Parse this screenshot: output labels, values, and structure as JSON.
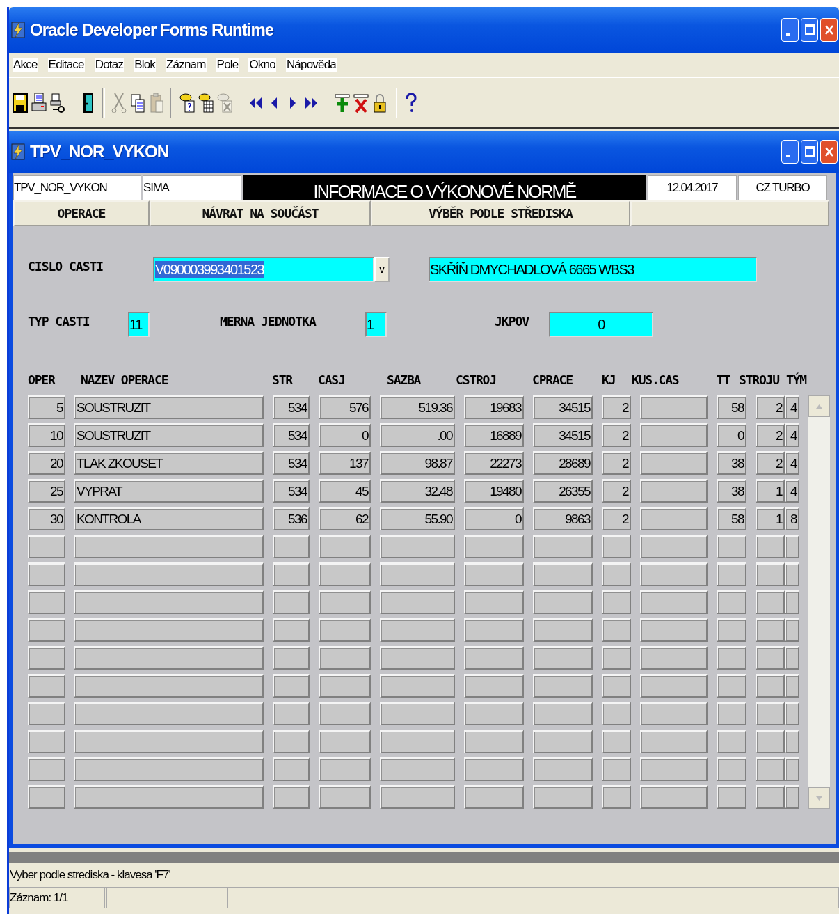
{
  "window": {
    "title": "Oracle Developer Forms Runtime",
    "controls": [
      {
        "kind": "minimize"
      },
      {
        "kind": "maximize"
      },
      {
        "kind": "close"
      }
    ]
  },
  "menu": [
    "Akce",
    "Editace",
    "Dotaz",
    "Blok",
    "Záznam",
    "Pole",
    "Okno",
    "Nápověda"
  ],
  "toolbar_groups": [
    {
      "tools": [
        {
          "kind": "save",
          "disabled": false
        },
        {
          "kind": "print",
          "disabled": false
        },
        {
          "kind": "print-setup",
          "disabled": false
        }
      ]
    },
    {
      "tools": [
        {
          "kind": "exit",
          "disabled": false
        }
      ]
    },
    {
      "tools": [
        {
          "kind": "cut",
          "disabled": true
        },
        {
          "kind": "copy",
          "disabled": false
        },
        {
          "kind": "paste",
          "disabled": true
        }
      ]
    },
    {
      "tools": [
        {
          "kind": "query",
          "disabled": false
        },
        {
          "kind": "execute",
          "disabled": false
        },
        {
          "kind": "cancel-query",
          "disabled": true
        }
      ]
    },
    {
      "tools": [
        {
          "kind": "first",
          "disabled": false
        },
        {
          "kind": "previous",
          "disabled": false
        },
        {
          "kind": "next",
          "disabled": false
        },
        {
          "kind": "last",
          "disabled": false
        }
      ]
    },
    {
      "tools": [
        {
          "kind": "insert",
          "disabled": false
        },
        {
          "kind": "delete",
          "disabled": false
        },
        {
          "kind": "lock",
          "disabled": false
        }
      ]
    },
    {
      "tools": [
        {
          "kind": "help",
          "disabled": false
        }
      ]
    }
  ],
  "form_window": {
    "title": "TPV_NOR_VYKON",
    "controls": [
      {
        "kind": "minimize"
      },
      {
        "kind": "maximize"
      },
      {
        "kind": "close"
      }
    ]
  },
  "header": {
    "form_name": "TPV_NOR_VYKON",
    "user": "SIMA",
    "banner": "INFORMACE O VÝKONOVÉ NORMĚ",
    "date": "12.04.2017",
    "company": "CZ TURBO"
  },
  "buttons": [
    {
      "label": "OPERACE"
    },
    {
      "label": "NÁVRAT NA SOUČÁST"
    },
    {
      "label": "VÝBĚR PODLE STŘEDISKA"
    }
  ],
  "fields": {
    "cislo_casti": {
      "label": "CISLO CASTI",
      "value": "V090003993401523",
      "selected_text": true,
      "dropdown": "v"
    },
    "description": {
      "value": "SKŘÍŇ DMYCHADLOVÁ 6665 WBS3"
    },
    "typ_casti": {
      "label": "TYP CASTI",
      "value": "11"
    },
    "merna_jednotka": {
      "label": "MERNA JEDNOTKA",
      "value": "1"
    },
    "jkpov": {
      "label": "JKPOV",
      "value": "0"
    }
  },
  "table": {
    "columns": [
      "OPER",
      "NAZEV OPERACE",
      "STR",
      "CASJ",
      "SAZBA",
      "CSTROJ",
      "CPRACE",
      "KJ",
      "KUS.CAS",
      "TT",
      "STROJU",
      "TÝM"
    ],
    "rows": [
      {
        "oper": "5",
        "nazev_operace": "SOUSTRUZIT",
        "str": "534",
        "casj": "576",
        "sazba": "519.36",
        "cstroj": "19683",
        "cprace": "34515",
        "kj": "2",
        "tt": "58",
        "stroju": "2",
        "tym": "4"
      },
      {
        "oper": "10",
        "nazev_operace": "SOUSTRUZIT",
        "str": "534",
        "casj": "0",
        "sazba": ".00",
        "cstroj": "16889",
        "cprace": "34515",
        "kj": "2",
        "tt": "0",
        "stroju": "2",
        "tym": "4"
      },
      {
        "oper": "20",
        "nazev_operace": "TLAK ZKOUSET",
        "str": "534",
        "casj": "137",
        "sazba": "98.87",
        "cstroj": "22273",
        "cprace": "28689",
        "kj": "2",
        "tt": "38",
        "stroju": "2",
        "tym": "4"
      },
      {
        "oper": "25",
        "nazev_operace": "VYPRAT",
        "str": "534",
        "casj": "45",
        "sazba": "32.48",
        "cstroj": "19480",
        "cprace": "26355",
        "kj": "2",
        "tt": "38",
        "stroju": "1",
        "tym": "4"
      },
      {
        "oper": "30",
        "nazev_operace": "KONTROLA",
        "str": "536",
        "casj": "62",
        "sazba": "55.90",
        "cstroj": "0",
        "cprace": "9863",
        "kj": "2",
        "tt": "58",
        "stroju": "1",
        "tym": "8"
      }
    ]
  },
  "status_bar": {
    "message": "Vyber podle strediska - klavesa 'F7'",
    "record": "Záznam: 1/1"
  }
}
